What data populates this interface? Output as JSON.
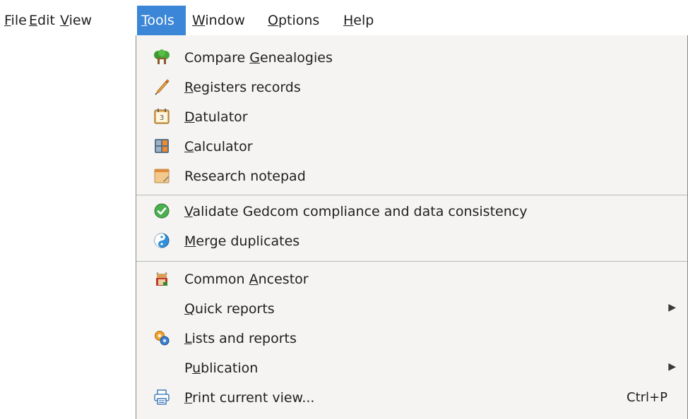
{
  "menubar": {
    "items": [
      {
        "pre": "",
        "ul": "F",
        "post": "ile"
      },
      {
        "pre": "",
        "ul": "E",
        "post": "dit"
      },
      {
        "pre": "",
        "ul": "V",
        "post": "iew"
      },
      {
        "pre": "",
        "ul": "T",
        "post": "ools"
      },
      {
        "pre": "",
        "ul": "W",
        "post": "indow"
      },
      {
        "pre": "",
        "ul": "O",
        "post": "ptions"
      },
      {
        "pre": "",
        "ul": "H",
        "post": "elp"
      }
    ],
    "active_index": 3,
    "active_color": "#3b86d6"
  },
  "tools_menu": {
    "items": [
      {
        "pre": "Compare ",
        "ul": "G",
        "post": "enealogies",
        "icon": "tree-icon"
      },
      {
        "pre": "",
        "ul": "R",
        "post": "egisters records",
        "icon": "quill-icon"
      },
      {
        "pre": "",
        "ul": "D",
        "post": "atulator",
        "icon": "calendar-icon"
      },
      {
        "pre": "",
        "ul": "C",
        "post": "alculator",
        "icon": "calculator-icon"
      },
      {
        "pre": "Research notepad",
        "ul": "",
        "post": "",
        "icon": "notepad-icon"
      },
      {
        "pre": "",
        "ul": "V",
        "post": "alidate Gedcom compliance and data consistency",
        "icon": "check-circle-icon"
      },
      {
        "pre": "",
        "ul": "M",
        "post": "erge duplicates",
        "icon": "merge-icon"
      },
      {
        "pre": "Common ",
        "ul": "A",
        "post": "ncestor",
        "icon": "ancestor-icon"
      },
      {
        "pre": "",
        "ul": "Q",
        "post": "uick reports",
        "icon": "",
        "submenu": true
      },
      {
        "pre": "",
        "ul": "L",
        "post": "ists and reports",
        "icon": "reports-icon"
      },
      {
        "pre": "P",
        "ul": "u",
        "post": "blication",
        "icon": "",
        "submenu": true
      },
      {
        "pre": "",
        "ul": "P",
        "post": "rint current view...",
        "icon": "printer-icon",
        "shortcut": "Ctrl+P"
      }
    ],
    "submenu_arrow": "▶"
  }
}
